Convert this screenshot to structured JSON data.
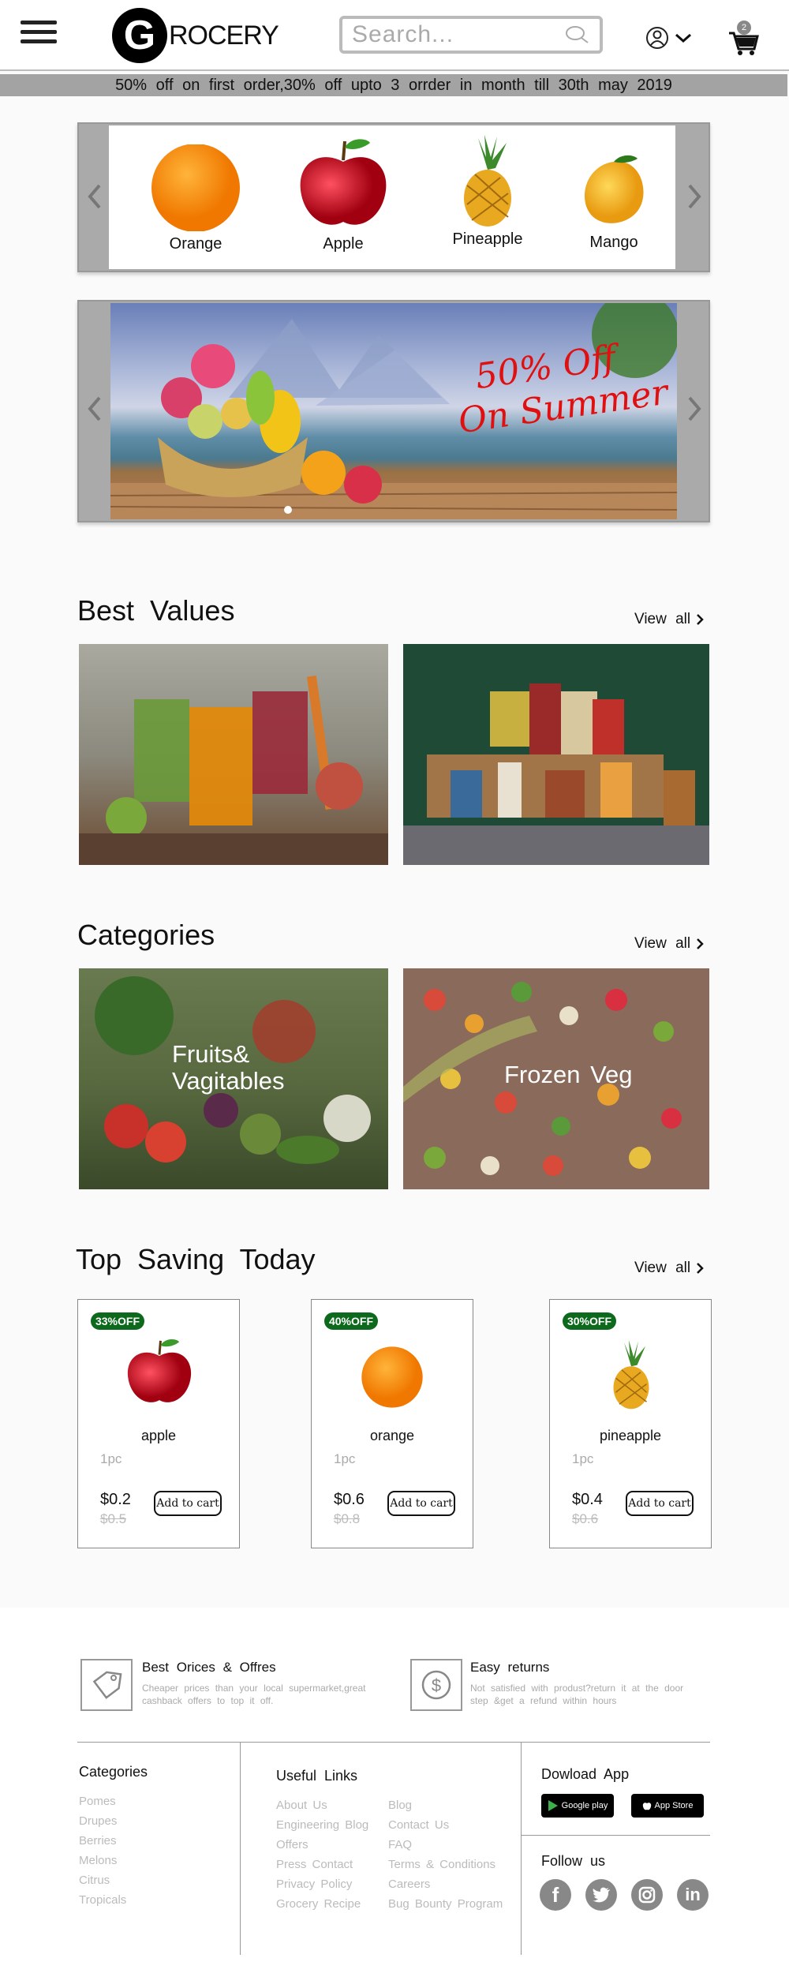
{
  "header": {
    "logo_letter": "G",
    "logo_text": "ROCERY",
    "search_placeholder": "Search...",
    "cart_count": "2"
  },
  "promo": "50% off on first order,30% off upto 3 orrder in month till 30th may 2019",
  "fruit_carousel": [
    {
      "label": "Orange"
    },
    {
      "label": "Apple"
    },
    {
      "label": "Pineapple"
    },
    {
      "label": "Mango"
    }
  ],
  "banner": {
    "line1": "50% Off",
    "line2": "On Summer"
  },
  "best_values": {
    "title": "Best Values",
    "view_all": "View all"
  },
  "categories": {
    "title": "Categories",
    "view_all": "View all",
    "items": [
      {
        "line1": "Fruits&",
        "line2": "Vagitables"
      },
      {
        "label": "Frozen Veg"
      }
    ]
  },
  "top_saving": {
    "title": "Top Saving Today",
    "view_all": "View all",
    "products": [
      {
        "badge": "33%OFF",
        "name": "apple",
        "qty": "1pc",
        "price": "$0.2",
        "old_price": "$0.5",
        "button": "Add to cart"
      },
      {
        "badge": "40%OFF",
        "name": "orange",
        "qty": "1pc",
        "price": "$0.6",
        "old_price": "$0.8",
        "button": "Add to cart"
      },
      {
        "badge": "30%OFF",
        "name": "pineapple",
        "qty": "1pc",
        "price": "$0.4",
        "old_price": "$0.6",
        "button": "Add to cart"
      }
    ]
  },
  "footer": {
    "features": [
      {
        "title": "Best Orices & Offres",
        "desc1": "Cheaper prices than your local supermarket,great",
        "desc2": "cashback offers to top it off."
      },
      {
        "title": "Easy returns",
        "desc1": "Not satisfied with produst?return it at the door",
        "desc2": "step &get a refund within hours"
      }
    ],
    "categories_heading": "Categories",
    "categories": [
      "Pomes",
      "Drupes",
      "Berries",
      "Melons",
      "Citrus",
      "Tropicals"
    ],
    "useful_links_heading": "Useful Links",
    "links_col1": [
      "About Us",
      "Engineering Blog",
      "Offers",
      "Press Contact",
      "Privacy Policy",
      "Grocery Recipe"
    ],
    "links_col2": [
      "Blog",
      "Contact Us",
      "FAQ",
      "Terms & Conditions",
      "Careers",
      "Bug Bounty Program"
    ],
    "download_heading": "Dowload App",
    "google_play": "Google play",
    "app_store": "App Store",
    "follow_heading": "Follow us"
  }
}
